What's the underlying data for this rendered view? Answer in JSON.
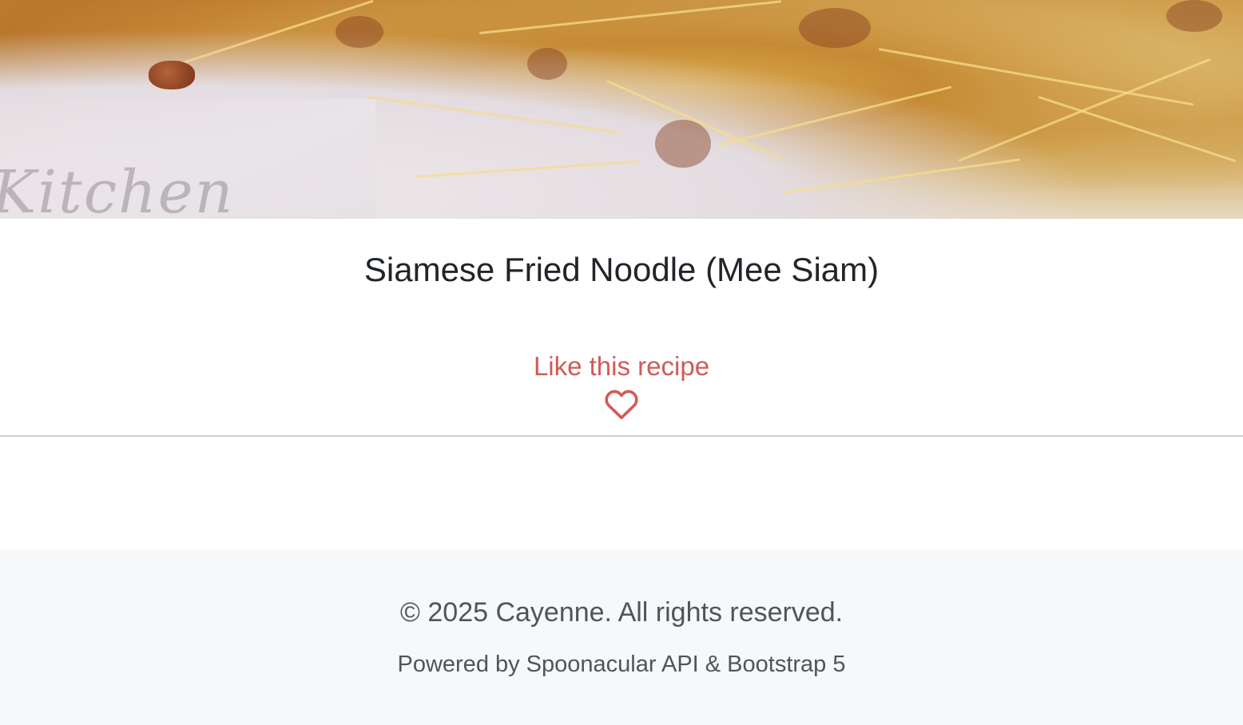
{
  "recipe": {
    "image_watermark": "Kitchen",
    "title": "Siamese Fried Noodle (Mee Siam)"
  },
  "like": {
    "label": "Like this recipe",
    "icon": "heart-outline-icon",
    "color": "#d05b57"
  },
  "footer": {
    "copyright": "© 2025 Cayenne. All rights reserved.",
    "powered_by": "Powered by Spoonacular API & Bootstrap 5",
    "background": "#f7f8fa"
  }
}
